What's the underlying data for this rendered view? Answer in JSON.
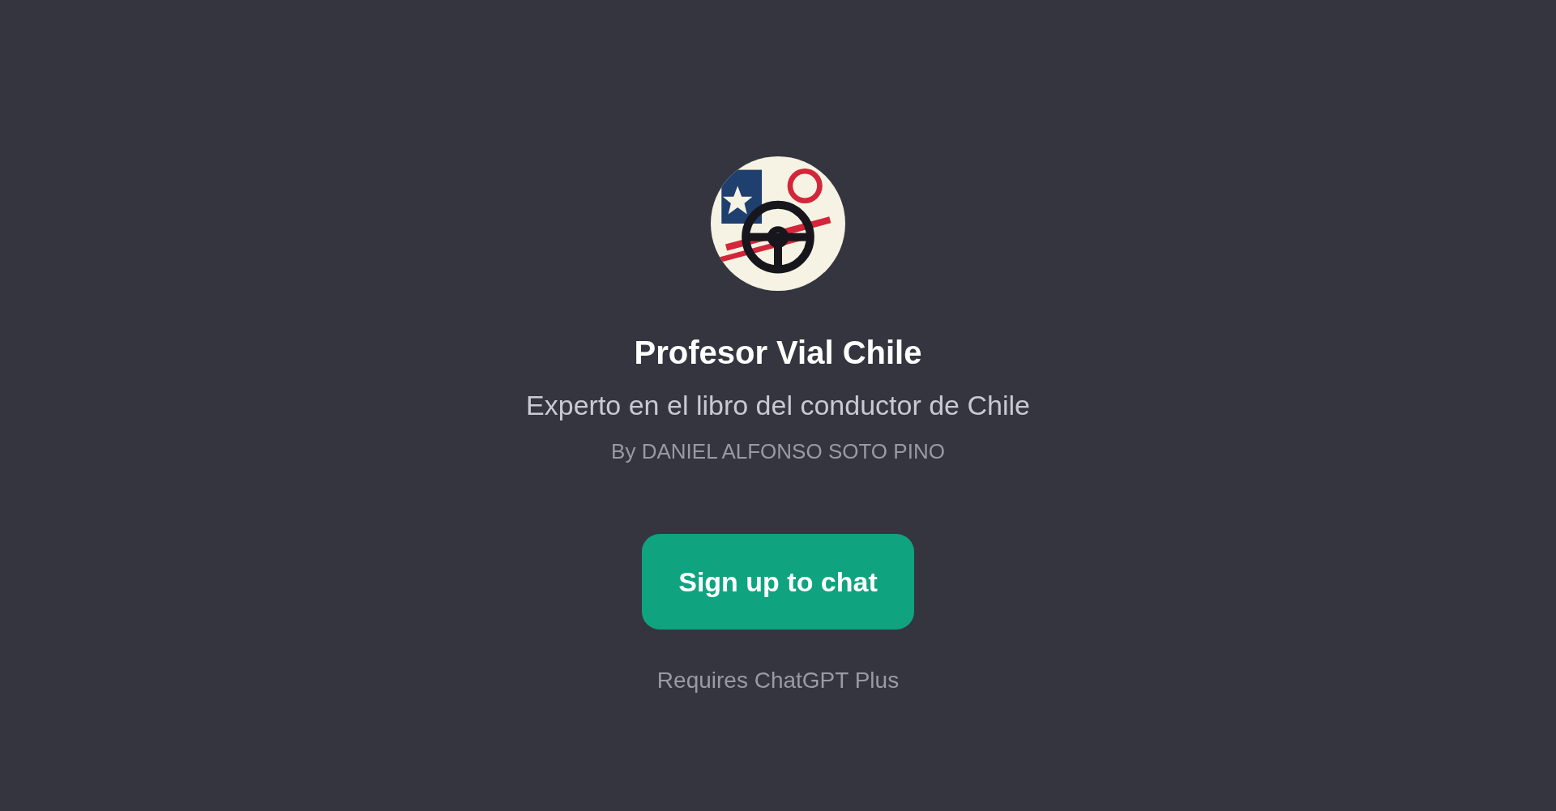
{
  "gpt": {
    "title": "Profesor Vial Chile",
    "description": "Experto en el libro del conductor de Chile",
    "author": "By DANIEL ALFONSO SOTO PINO"
  },
  "signup_button": "Sign up to chat",
  "note": "Requires ChatGPT Plus"
}
